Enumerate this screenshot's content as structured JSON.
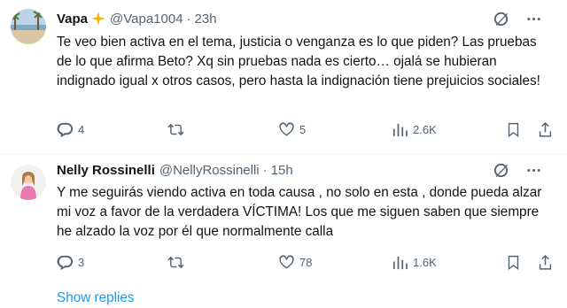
{
  "tweets": [
    {
      "name": "Vapa",
      "handle": "@Vapa1004",
      "time": "23h",
      "text": "Te veo bien activa en el tema, justicia o venganza es lo que piden? Las pruebas de lo que afirma Beto? Xq sin pruebas nada es cierto… ojalá se hubieran indignado igual x otros casos, pero hasta la indignación tiene prejuicios sociales!",
      "replies": "4",
      "retweets": "",
      "likes": "5",
      "views": "2.6K",
      "avatar": "beach-avatar"
    },
    {
      "name": "Nelly Rossinelli",
      "handle": "@NellyRossinelli",
      "time": "15h",
      "text": "Y me seguirás viendo activa en toda causa , no solo en esta , donde pueda alzar mi voz a favor de la verdadera VÍCTIMA! Los que me siguen saben que siempre he alzado la voz por él que normalmente calla",
      "replies": "3",
      "retweets": "",
      "likes": "78",
      "views": "1.6K",
      "avatar": "woman-avatar"
    }
  ],
  "show_replies": "Show replies",
  "dot": "·",
  "colors": {
    "text": "#0f1419",
    "muted": "#536471",
    "link": "#1d9bf0",
    "sparkle": "#f4b400"
  },
  "icons": [
    "grok-icon",
    "more-icon",
    "reply-icon",
    "retweet-icon",
    "like-icon",
    "views-icon",
    "bookmark-icon",
    "share-icon",
    "sparkle-icon"
  ]
}
